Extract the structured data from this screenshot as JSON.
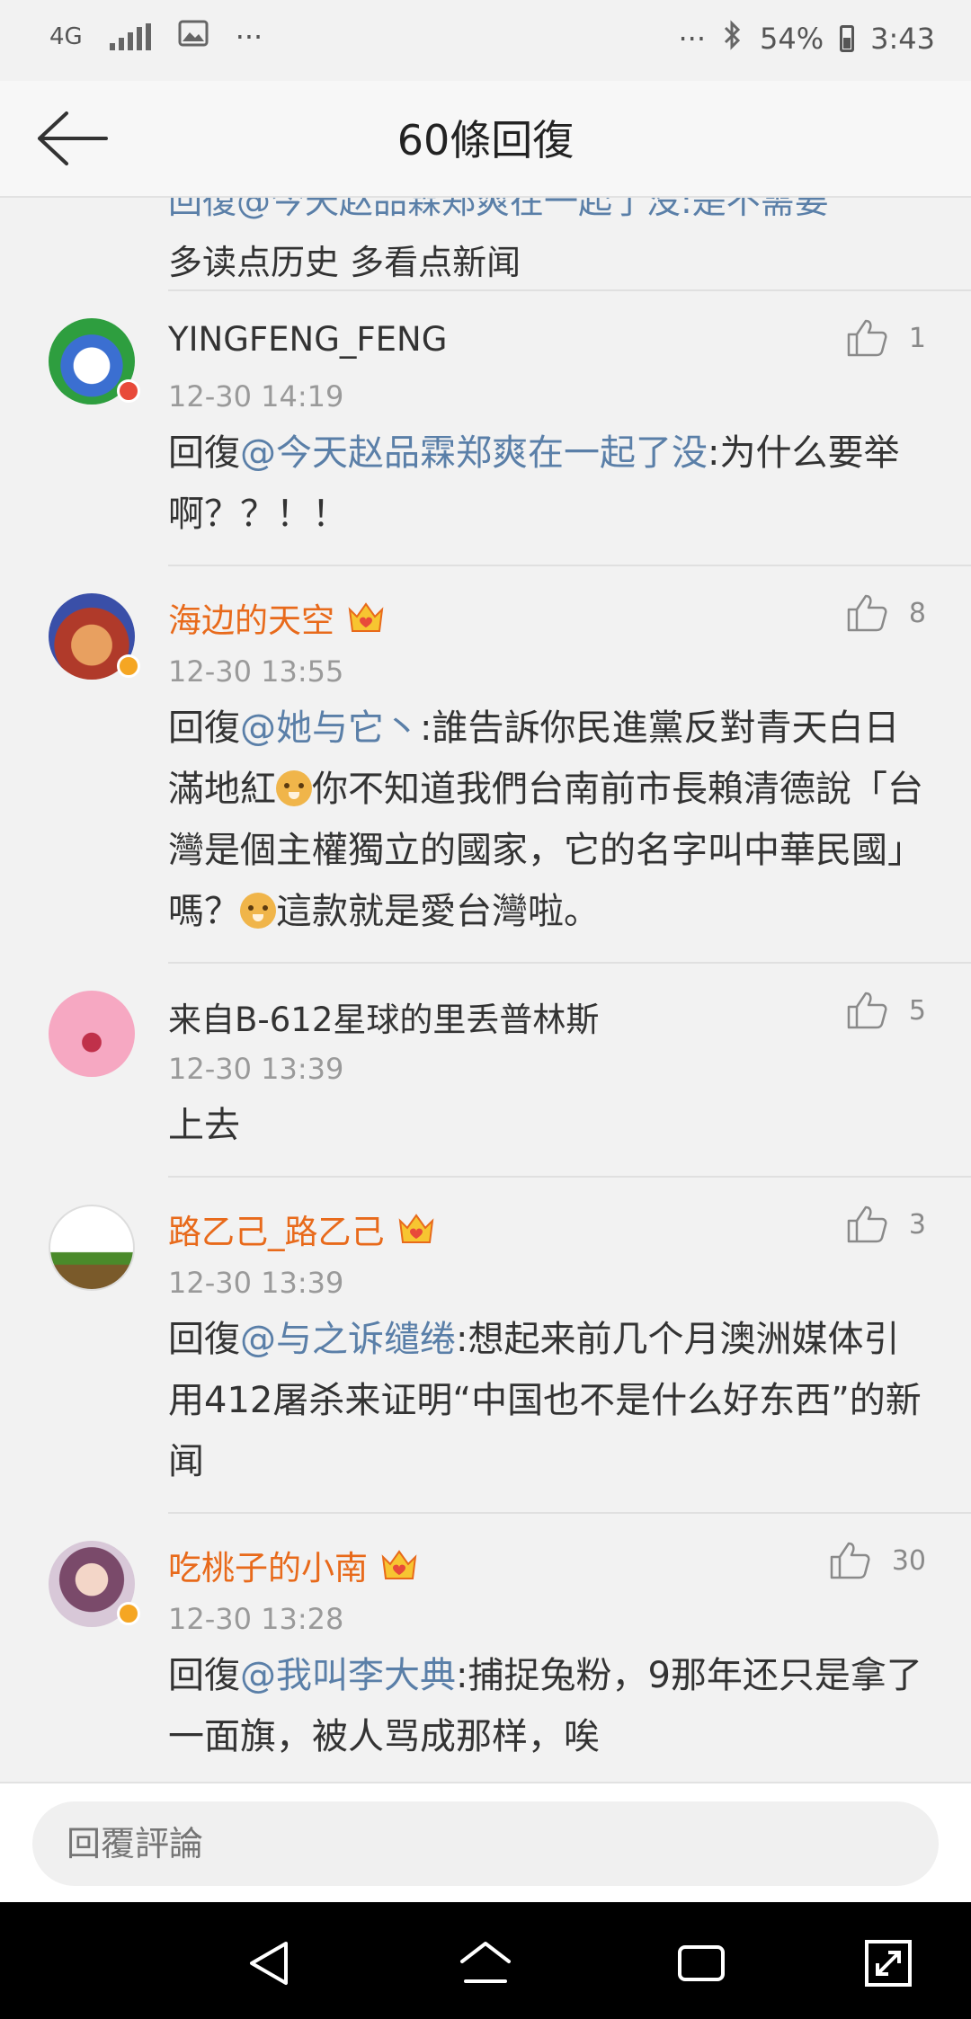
{
  "status_bar": {
    "network": "4G",
    "battery": "54%",
    "time": "3:43",
    "more_left": "···",
    "more_right": "···"
  },
  "header": {
    "title": "60條回復"
  },
  "partial_comment": {
    "text_line": "多读点历史 多看点新闻"
  },
  "comments": [
    {
      "username": "YINGFENG_FENG",
      "time": "12-30 14:19",
      "likes": "1",
      "prefix": "回復",
      "mention": "@今天赵品霖郑爽在一起了没",
      "body": ":为什么要举啊？？！！"
    },
    {
      "username": "海边的天空",
      "time": "12-30 13:55",
      "likes": "8",
      "prefix": "回復",
      "mention": "@她与它丶",
      "body_1": ":誰告訴你民進黨反對青天白日滿地紅",
      "body_2": "你不知道我們台南前市長賴清德說「台灣是個主權獨立的國家，它的名字叫中華民國」嗎？",
      "body_3": "這款就是愛台灣啦。"
    },
    {
      "username": "来自B-612星球的里丢普林斯",
      "time": "12-30 13:39",
      "likes": "5",
      "body": "上去"
    },
    {
      "username": "路乙己_路乙己",
      "time": "12-30 13:39",
      "likes": "3",
      "prefix": "回復",
      "mention": "@与之诉缱绻",
      "body": ":想起来前几个月澳洲媒体引用412屠杀来证明“中国也不是什么好东西”的新闻"
    },
    {
      "username": "吃桃子的小南",
      "time": "12-30 13:28",
      "likes": "30",
      "prefix": "回復",
      "mention": "@我叫李大典",
      "body": ":捕捉兔粉，9那年还只是拿了一面旗，被人骂成那样，唉"
    }
  ],
  "reply_bar": {
    "placeholder": "回覆評論"
  },
  "colors": {
    "mention": "#5a7fa8",
    "vip_name": "#e86a1b",
    "verified_badge": "#f5a623",
    "background": "#f2f2f2"
  }
}
